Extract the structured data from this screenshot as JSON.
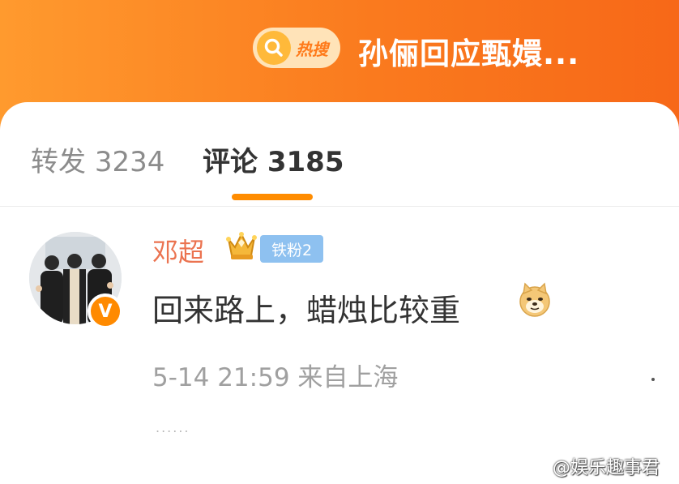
{
  "header": {
    "hot_label": "热搜",
    "title": "孙俪回应甄嬛..."
  },
  "tabs": [
    {
      "label": "转发",
      "count": "3234"
    },
    {
      "label": "评论",
      "count": "3185"
    }
  ],
  "comment": {
    "username": "邓超",
    "fan_badge": "铁粉2",
    "verified_badge": "V",
    "text": "回来路上，蜡烛比较重",
    "emoji": "doge-icon",
    "time": "5-14 21:59",
    "location": "来自上海",
    "more_dots": "......"
  },
  "watermark": "@娱乐趣事君",
  "colors": {
    "header_orange": "#fa7a1e",
    "username": "#eb7350",
    "tab_underline": "#ff8c00",
    "fan_badge": "#8ec1f0"
  }
}
